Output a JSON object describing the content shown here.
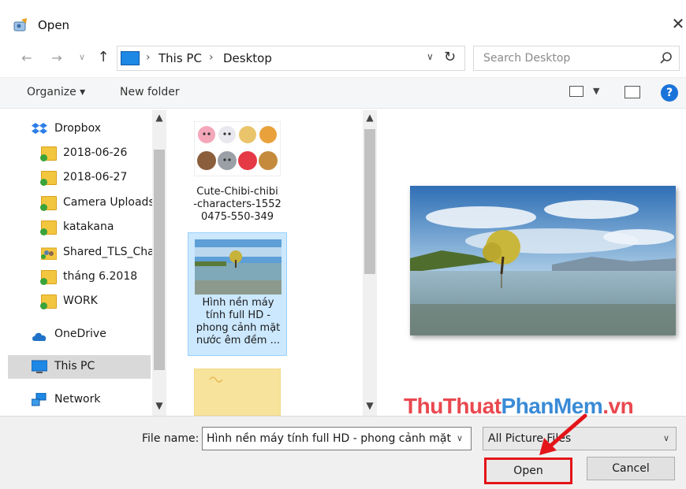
{
  "window": {
    "title": "Open"
  },
  "address": {
    "crumbs": [
      "This PC",
      "Desktop"
    ],
    "search_placeholder": "Search Desktop"
  },
  "toolbar": {
    "organize_label": "Organize ▾",
    "new_folder_label": "New folder",
    "help_label": "?"
  },
  "nav": {
    "items": [
      {
        "label": "Dropbox",
        "icon": "dropbox-icon"
      },
      {
        "label": "2018-06-26",
        "icon": "folder-icon"
      },
      {
        "label": "2018-06-27",
        "icon": "folder-icon"
      },
      {
        "label": "Camera Uploads",
        "icon": "folder-icon"
      },
      {
        "label": "katakana",
        "icon": "folder-icon"
      },
      {
        "label": "Shared_TLS_Cha",
        "icon": "shared-folder-icon"
      },
      {
        "label": "tháng 6.2018",
        "icon": "folder-icon"
      },
      {
        "label": "WORK",
        "icon": "folder-icon"
      },
      {
        "label": "OneDrive",
        "icon": "onedrive-icon"
      },
      {
        "label": "This PC",
        "icon": "this-pc-icon",
        "selected": true
      },
      {
        "label": "Network",
        "icon": "network-icon"
      }
    ]
  },
  "files": [
    {
      "name_lines": [
        "Cute-Chibi-chibi",
        "-characters-1552",
        "0475-550-349"
      ]
    },
    {
      "name_lines": [
        "Hình nền máy",
        "tính full HD -",
        "phong cảnh mặt",
        "nước êm đềm ..."
      ],
      "selected": true
    },
    {
      "name_lines": []
    }
  ],
  "bottom": {
    "file_name_label": "File name:",
    "file_name_value": "Hình nền máy tính full HD - phong cảnh mặt",
    "filter_value": "All Picture Files",
    "open_label": "Open",
    "cancel_label": "Cancel"
  },
  "watermark": {
    "part1": "ThuThuat",
    "part2": "PhanMem",
    "part3": ".vn"
  },
  "colors": {
    "accent": "#1a73d9",
    "selection": "#cce8ff",
    "highlight_box": "#e3151a"
  }
}
